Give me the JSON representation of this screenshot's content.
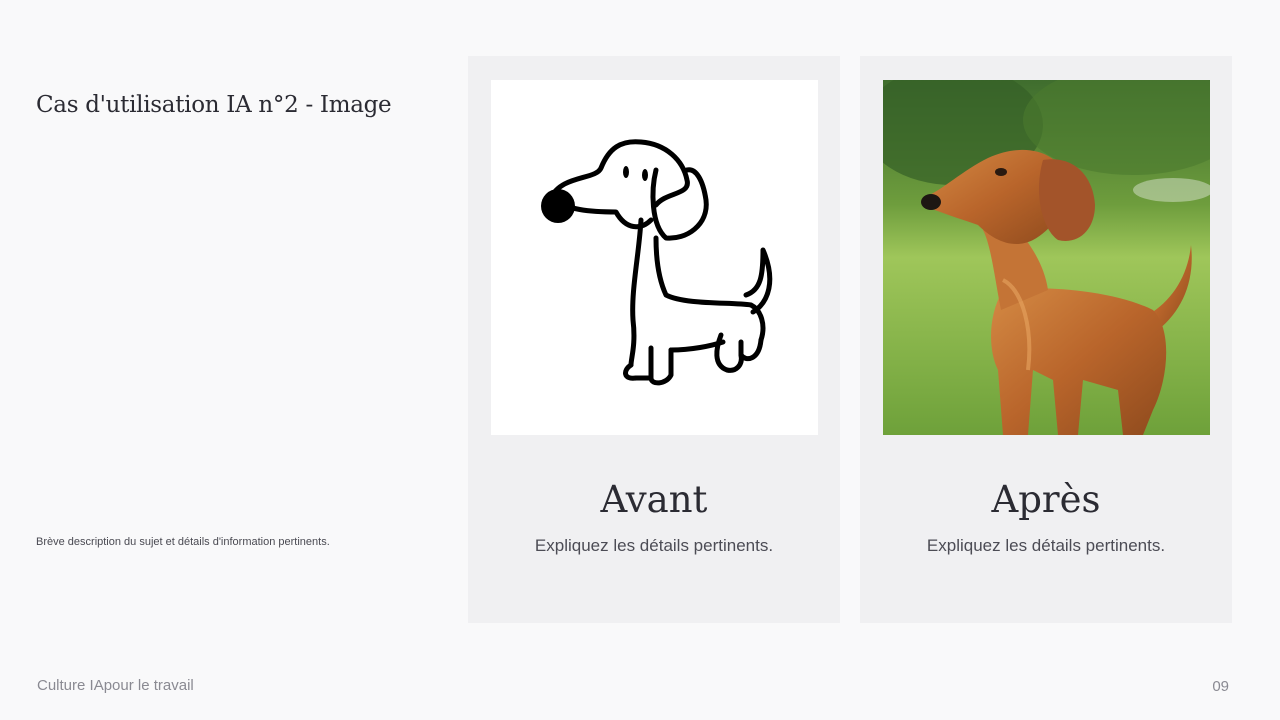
{
  "slide": {
    "title": "Cas d'utilisation IA n°2 - Image",
    "description": "Brève description du sujet et détails d'information pertinents."
  },
  "cards": [
    {
      "heading": "Avant",
      "text": "Expliquez les détails pertinents.",
      "image": "dog-sketch-drawing"
    },
    {
      "heading": "Après",
      "text": "Expliquez les détails pertinents.",
      "image": "dachshund-photo"
    }
  ],
  "footer": {
    "left": "Culture IApour le travail",
    "page_number": "09"
  },
  "colors": {
    "background": "#f9f9fa",
    "card": "#f0f0f2",
    "text_dark": "#2b2b33",
    "text_muted": "#8a8a92"
  }
}
